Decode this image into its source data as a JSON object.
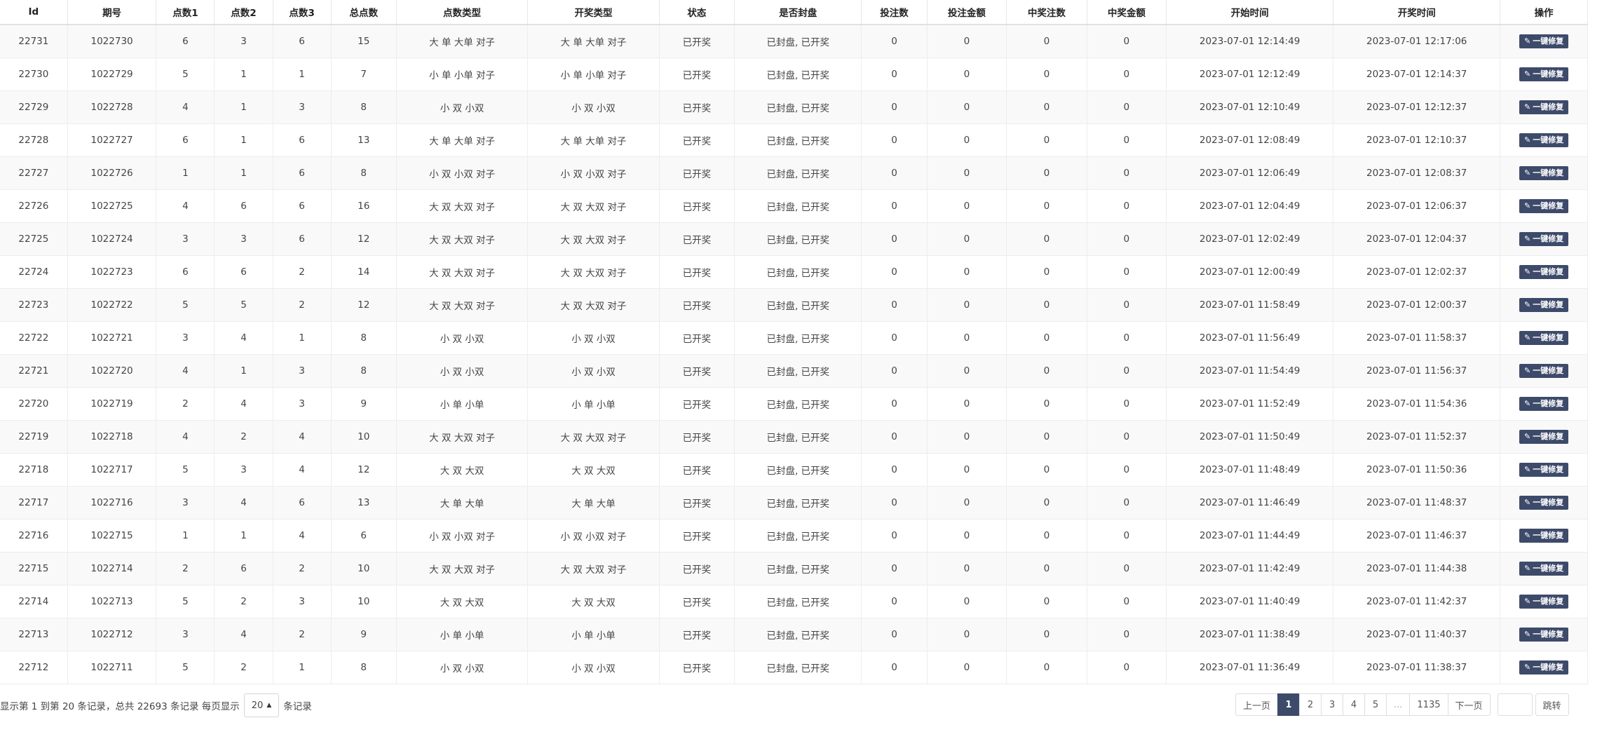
{
  "table": {
    "columns": [
      "Id",
      "期号",
      "点数1",
      "点数2",
      "点数3",
      "总点数",
      "点数类型",
      "开奖类型",
      "状态",
      "是否封盘",
      "投注数",
      "投注金额",
      "中奖注数",
      "中奖金额",
      "开始时间",
      "开奖时间",
      "操作"
    ],
    "action_label": "一键修复",
    "rows": [
      [
        "22731",
        "1022730",
        "6",
        "3",
        "6",
        "15",
        "大 单 大单 对子",
        "大 单 大单 对子",
        "已开奖",
        "已封盘, 已开奖",
        "0",
        "0",
        "0",
        "0",
        "2023-07-01 12:14:49",
        "2023-07-01 12:17:06"
      ],
      [
        "22730",
        "1022729",
        "5",
        "1",
        "1",
        "7",
        "小 单 小单 对子",
        "小 单 小单 对子",
        "已开奖",
        "已封盘, 已开奖",
        "0",
        "0",
        "0",
        "0",
        "2023-07-01 12:12:49",
        "2023-07-01 12:14:37"
      ],
      [
        "22729",
        "1022728",
        "4",
        "1",
        "3",
        "8",
        "小 双 小双",
        "小 双 小双",
        "已开奖",
        "已封盘, 已开奖",
        "0",
        "0",
        "0",
        "0",
        "2023-07-01 12:10:49",
        "2023-07-01 12:12:37"
      ],
      [
        "22728",
        "1022727",
        "6",
        "1",
        "6",
        "13",
        "大 单 大单 对子",
        "大 单 大单 对子",
        "已开奖",
        "已封盘, 已开奖",
        "0",
        "0",
        "0",
        "0",
        "2023-07-01 12:08:49",
        "2023-07-01 12:10:37"
      ],
      [
        "22727",
        "1022726",
        "1",
        "1",
        "6",
        "8",
        "小 双 小双 对子",
        "小 双 小双 对子",
        "已开奖",
        "已封盘, 已开奖",
        "0",
        "0",
        "0",
        "0",
        "2023-07-01 12:06:49",
        "2023-07-01 12:08:37"
      ],
      [
        "22726",
        "1022725",
        "4",
        "6",
        "6",
        "16",
        "大 双 大双 对子",
        "大 双 大双 对子",
        "已开奖",
        "已封盘, 已开奖",
        "0",
        "0",
        "0",
        "0",
        "2023-07-01 12:04:49",
        "2023-07-01 12:06:37"
      ],
      [
        "22725",
        "1022724",
        "3",
        "3",
        "6",
        "12",
        "大 双 大双 对子",
        "大 双 大双 对子",
        "已开奖",
        "已封盘, 已开奖",
        "0",
        "0",
        "0",
        "0",
        "2023-07-01 12:02:49",
        "2023-07-01 12:04:37"
      ],
      [
        "22724",
        "1022723",
        "6",
        "6",
        "2",
        "14",
        "大 双 大双 对子",
        "大 双 大双 对子",
        "已开奖",
        "已封盘, 已开奖",
        "0",
        "0",
        "0",
        "0",
        "2023-07-01 12:00:49",
        "2023-07-01 12:02:37"
      ],
      [
        "22723",
        "1022722",
        "5",
        "5",
        "2",
        "12",
        "大 双 大双 对子",
        "大 双 大双 对子",
        "已开奖",
        "已封盘, 已开奖",
        "0",
        "0",
        "0",
        "0",
        "2023-07-01 11:58:49",
        "2023-07-01 12:00:37"
      ],
      [
        "22722",
        "1022721",
        "3",
        "4",
        "1",
        "8",
        "小 双 小双",
        "小 双 小双",
        "已开奖",
        "已封盘, 已开奖",
        "0",
        "0",
        "0",
        "0",
        "2023-07-01 11:56:49",
        "2023-07-01 11:58:37"
      ],
      [
        "22721",
        "1022720",
        "4",
        "1",
        "3",
        "8",
        "小 双 小双",
        "小 双 小双",
        "已开奖",
        "已封盘, 已开奖",
        "0",
        "0",
        "0",
        "0",
        "2023-07-01 11:54:49",
        "2023-07-01 11:56:37"
      ],
      [
        "22720",
        "1022719",
        "2",
        "4",
        "3",
        "9",
        "小 单 小单",
        "小 单 小单",
        "已开奖",
        "已封盘, 已开奖",
        "0",
        "0",
        "0",
        "0",
        "2023-07-01 11:52:49",
        "2023-07-01 11:54:36"
      ],
      [
        "22719",
        "1022718",
        "4",
        "2",
        "4",
        "10",
        "大 双 大双 对子",
        "大 双 大双 对子",
        "已开奖",
        "已封盘, 已开奖",
        "0",
        "0",
        "0",
        "0",
        "2023-07-01 11:50:49",
        "2023-07-01 11:52:37"
      ],
      [
        "22718",
        "1022717",
        "5",
        "3",
        "4",
        "12",
        "大 双 大双",
        "大 双 大双",
        "已开奖",
        "已封盘, 已开奖",
        "0",
        "0",
        "0",
        "0",
        "2023-07-01 11:48:49",
        "2023-07-01 11:50:36"
      ],
      [
        "22717",
        "1022716",
        "3",
        "4",
        "6",
        "13",
        "大 单 大单",
        "大 单 大单",
        "已开奖",
        "已封盘, 已开奖",
        "0",
        "0",
        "0",
        "0",
        "2023-07-01 11:46:49",
        "2023-07-01 11:48:37"
      ],
      [
        "22716",
        "1022715",
        "1",
        "1",
        "4",
        "6",
        "小 双 小双 对子",
        "小 双 小双 对子",
        "已开奖",
        "已封盘, 已开奖",
        "0",
        "0",
        "0",
        "0",
        "2023-07-01 11:44:49",
        "2023-07-01 11:46:37"
      ],
      [
        "22715",
        "1022714",
        "2",
        "6",
        "2",
        "10",
        "大 双 大双 对子",
        "大 双 大双 对子",
        "已开奖",
        "已封盘, 已开奖",
        "0",
        "0",
        "0",
        "0",
        "2023-07-01 11:42:49",
        "2023-07-01 11:44:38"
      ],
      [
        "22714",
        "1022713",
        "5",
        "2",
        "3",
        "10",
        "大 双 大双",
        "大 双 大双",
        "已开奖",
        "已封盘, 已开奖",
        "0",
        "0",
        "0",
        "0",
        "2023-07-01 11:40:49",
        "2023-07-01 11:42:37"
      ],
      [
        "22713",
        "1022712",
        "3",
        "4",
        "2",
        "9",
        "小 单 小单",
        "小 单 小单",
        "已开奖",
        "已封盘, 已开奖",
        "0",
        "0",
        "0",
        "0",
        "2023-07-01 11:38:49",
        "2023-07-01 11:40:37"
      ],
      [
        "22712",
        "1022711",
        "5",
        "2",
        "1",
        "8",
        "小 双 小双",
        "小 双 小双",
        "已开奖",
        "已封盘, 已开奖",
        "0",
        "0",
        "0",
        "0",
        "2023-07-01 11:36:49",
        "2023-07-01 11:38:37"
      ]
    ]
  },
  "footer": {
    "info_prefix": "显示第 1 到第 20 条记录，总共 22693 条记录 每页显示",
    "page_size": "20",
    "info_suffix": "条记录"
  },
  "pagination": {
    "prev": "上一页",
    "pages": [
      "1",
      "2",
      "3",
      "4",
      "5",
      "...",
      "1135"
    ],
    "active": "1",
    "next": "下一页",
    "jump_value": "",
    "jump_label": "跳转"
  },
  "icons": {
    "fix_icon": "pencil-icon",
    "page_size_caret": "caret-up-icon"
  },
  "colors": {
    "primary_button": "#3d4a6a",
    "row_stripe": "#f9f9f9",
    "border": "#ededed"
  }
}
